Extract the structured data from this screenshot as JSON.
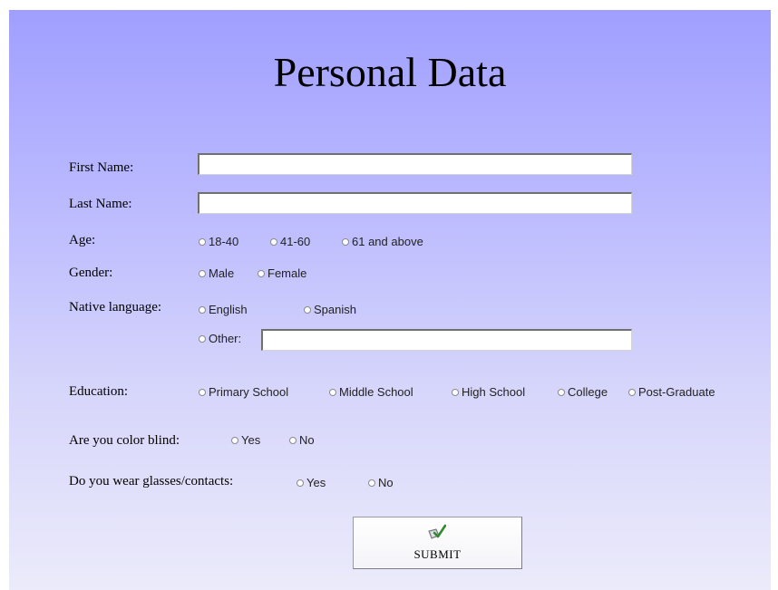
{
  "title": "Personal Data",
  "fields": {
    "first_name": {
      "label": "First Name:",
      "value": ""
    },
    "last_name": {
      "label": "Last Name:",
      "value": ""
    }
  },
  "age": {
    "label": "Age:",
    "options": [
      "18-40",
      "41-60",
      "61 and above"
    ]
  },
  "gender": {
    "label": "Gender:",
    "options": [
      "Male",
      "Female"
    ]
  },
  "native_language": {
    "label": "Native language:",
    "options": [
      "English",
      "Spanish"
    ],
    "other_label": "Other:",
    "other_value": ""
  },
  "education": {
    "label": "Education:",
    "options": [
      "Primary School",
      "Middle School",
      "High School",
      "College",
      "Post-Graduate"
    ]
  },
  "color_blind": {
    "label": "Are you color blind:",
    "options": [
      "Yes",
      "No"
    ]
  },
  "glasses": {
    "label": "Do you wear glasses/contacts:",
    "options": [
      "Yes",
      "No"
    ]
  },
  "submit": {
    "label": "SUBMIT",
    "icon": "submit-checkmark-icon"
  },
  "colors": {
    "background_top": "#a09fff",
    "background_bottom": "#ebebfb"
  }
}
